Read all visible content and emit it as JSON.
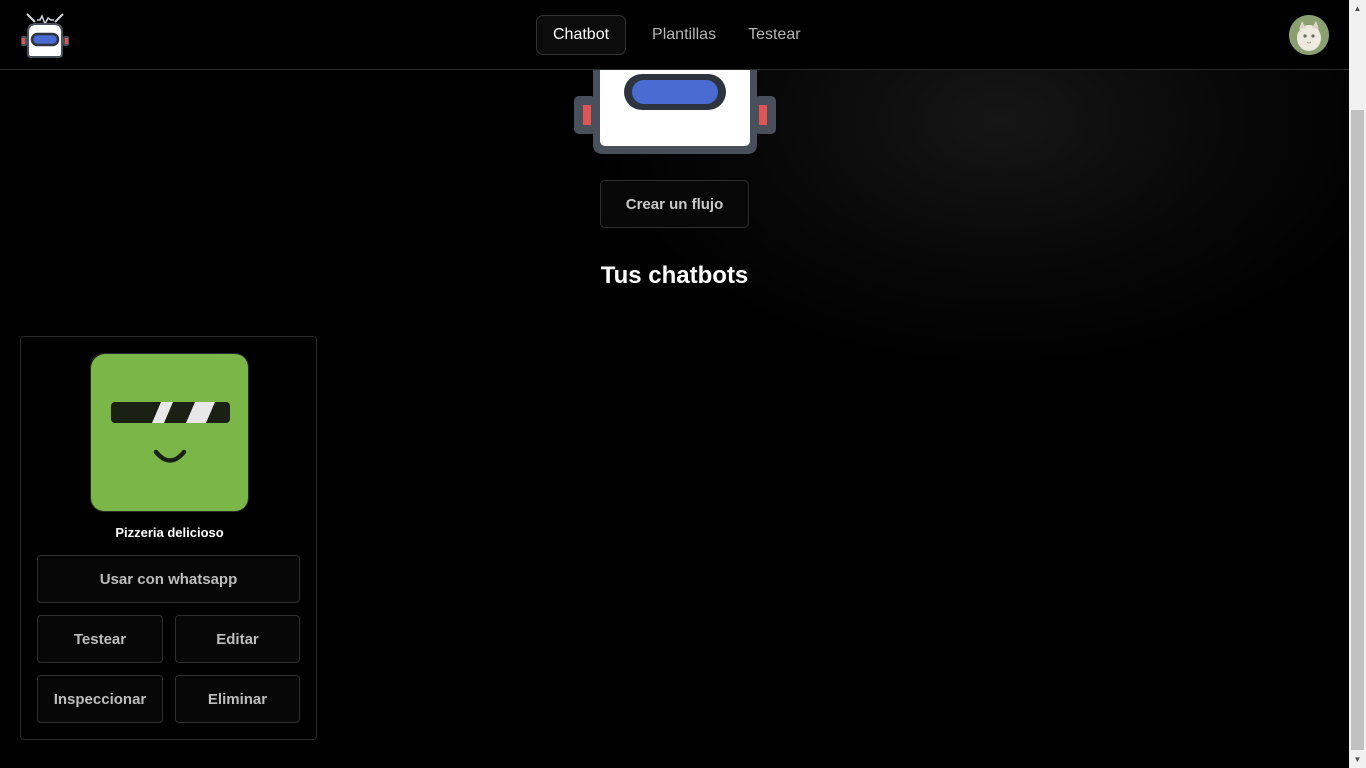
{
  "navbar": {
    "logo_icon": "robot-logo-icon",
    "tabs": [
      {
        "label": "Chatbot",
        "active": true
      },
      {
        "label": "Plantillas",
        "active": false
      },
      {
        "label": "Testear",
        "active": false
      }
    ],
    "avatar_icon": "user-avatar"
  },
  "hero": {
    "illustration": "robot-head-illustration",
    "create_label": "Crear un flujo"
  },
  "section": {
    "title": "Tus chatbots"
  },
  "chatbots": [
    {
      "name": "Pizzeria delicioso",
      "image": "green-bot-avatar",
      "image_color": "#7ab648",
      "actions": {
        "whatsapp": "Usar con whatsapp",
        "test": "Testear",
        "edit": "Editar",
        "inspect": "Inspeccionar",
        "delete": "Eliminar"
      }
    }
  ],
  "colors": {
    "background": "#000000",
    "accent_blue": "#4a6bd1",
    "accent_red": "#e05555",
    "card_green": "#7ab648"
  }
}
